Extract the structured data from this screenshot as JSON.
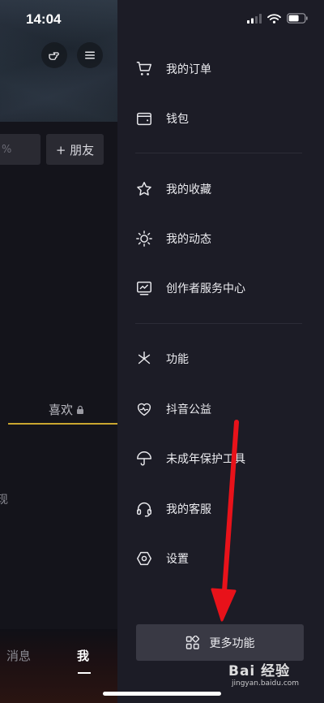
{
  "status_bar": {
    "time": "14:04"
  },
  "background_page": {
    "percent_text": "%",
    "add_friend_label": "+ 朋友",
    "likes_tab_label": "喜欢",
    "partial_text": "现",
    "nav_messages": "消息",
    "nav_me": "我"
  },
  "drawer": {
    "groups": [
      [
        {
          "label": "我的订单",
          "icon": "cart-icon"
        },
        {
          "label": "钱包",
          "icon": "wallet-icon"
        }
      ],
      [
        {
          "label": "我的收藏",
          "icon": "star-icon"
        },
        {
          "label": "我的动态",
          "icon": "sun-icon"
        },
        {
          "label": "创作者服务中心",
          "icon": "chart-icon"
        }
      ],
      [
        {
          "label": "功能",
          "icon": "sparkle-icon"
        },
        {
          "label": "抖音公益",
          "icon": "heart-icon"
        },
        {
          "label": "未成年保护工具",
          "icon": "umbrella-icon"
        },
        {
          "label": "我的客服",
          "icon": "headset-icon"
        },
        {
          "label": "设置",
          "icon": "settings-icon"
        }
      ]
    ],
    "more_button_label": "更多功能"
  },
  "watermark": {
    "main": "Bai 经验",
    "sub": "jingyan.baidu.com"
  },
  "colors": {
    "accent_gold": "#c9a630",
    "arrow_red": "#e8121a",
    "drawer_bg": "#1c1c26"
  }
}
